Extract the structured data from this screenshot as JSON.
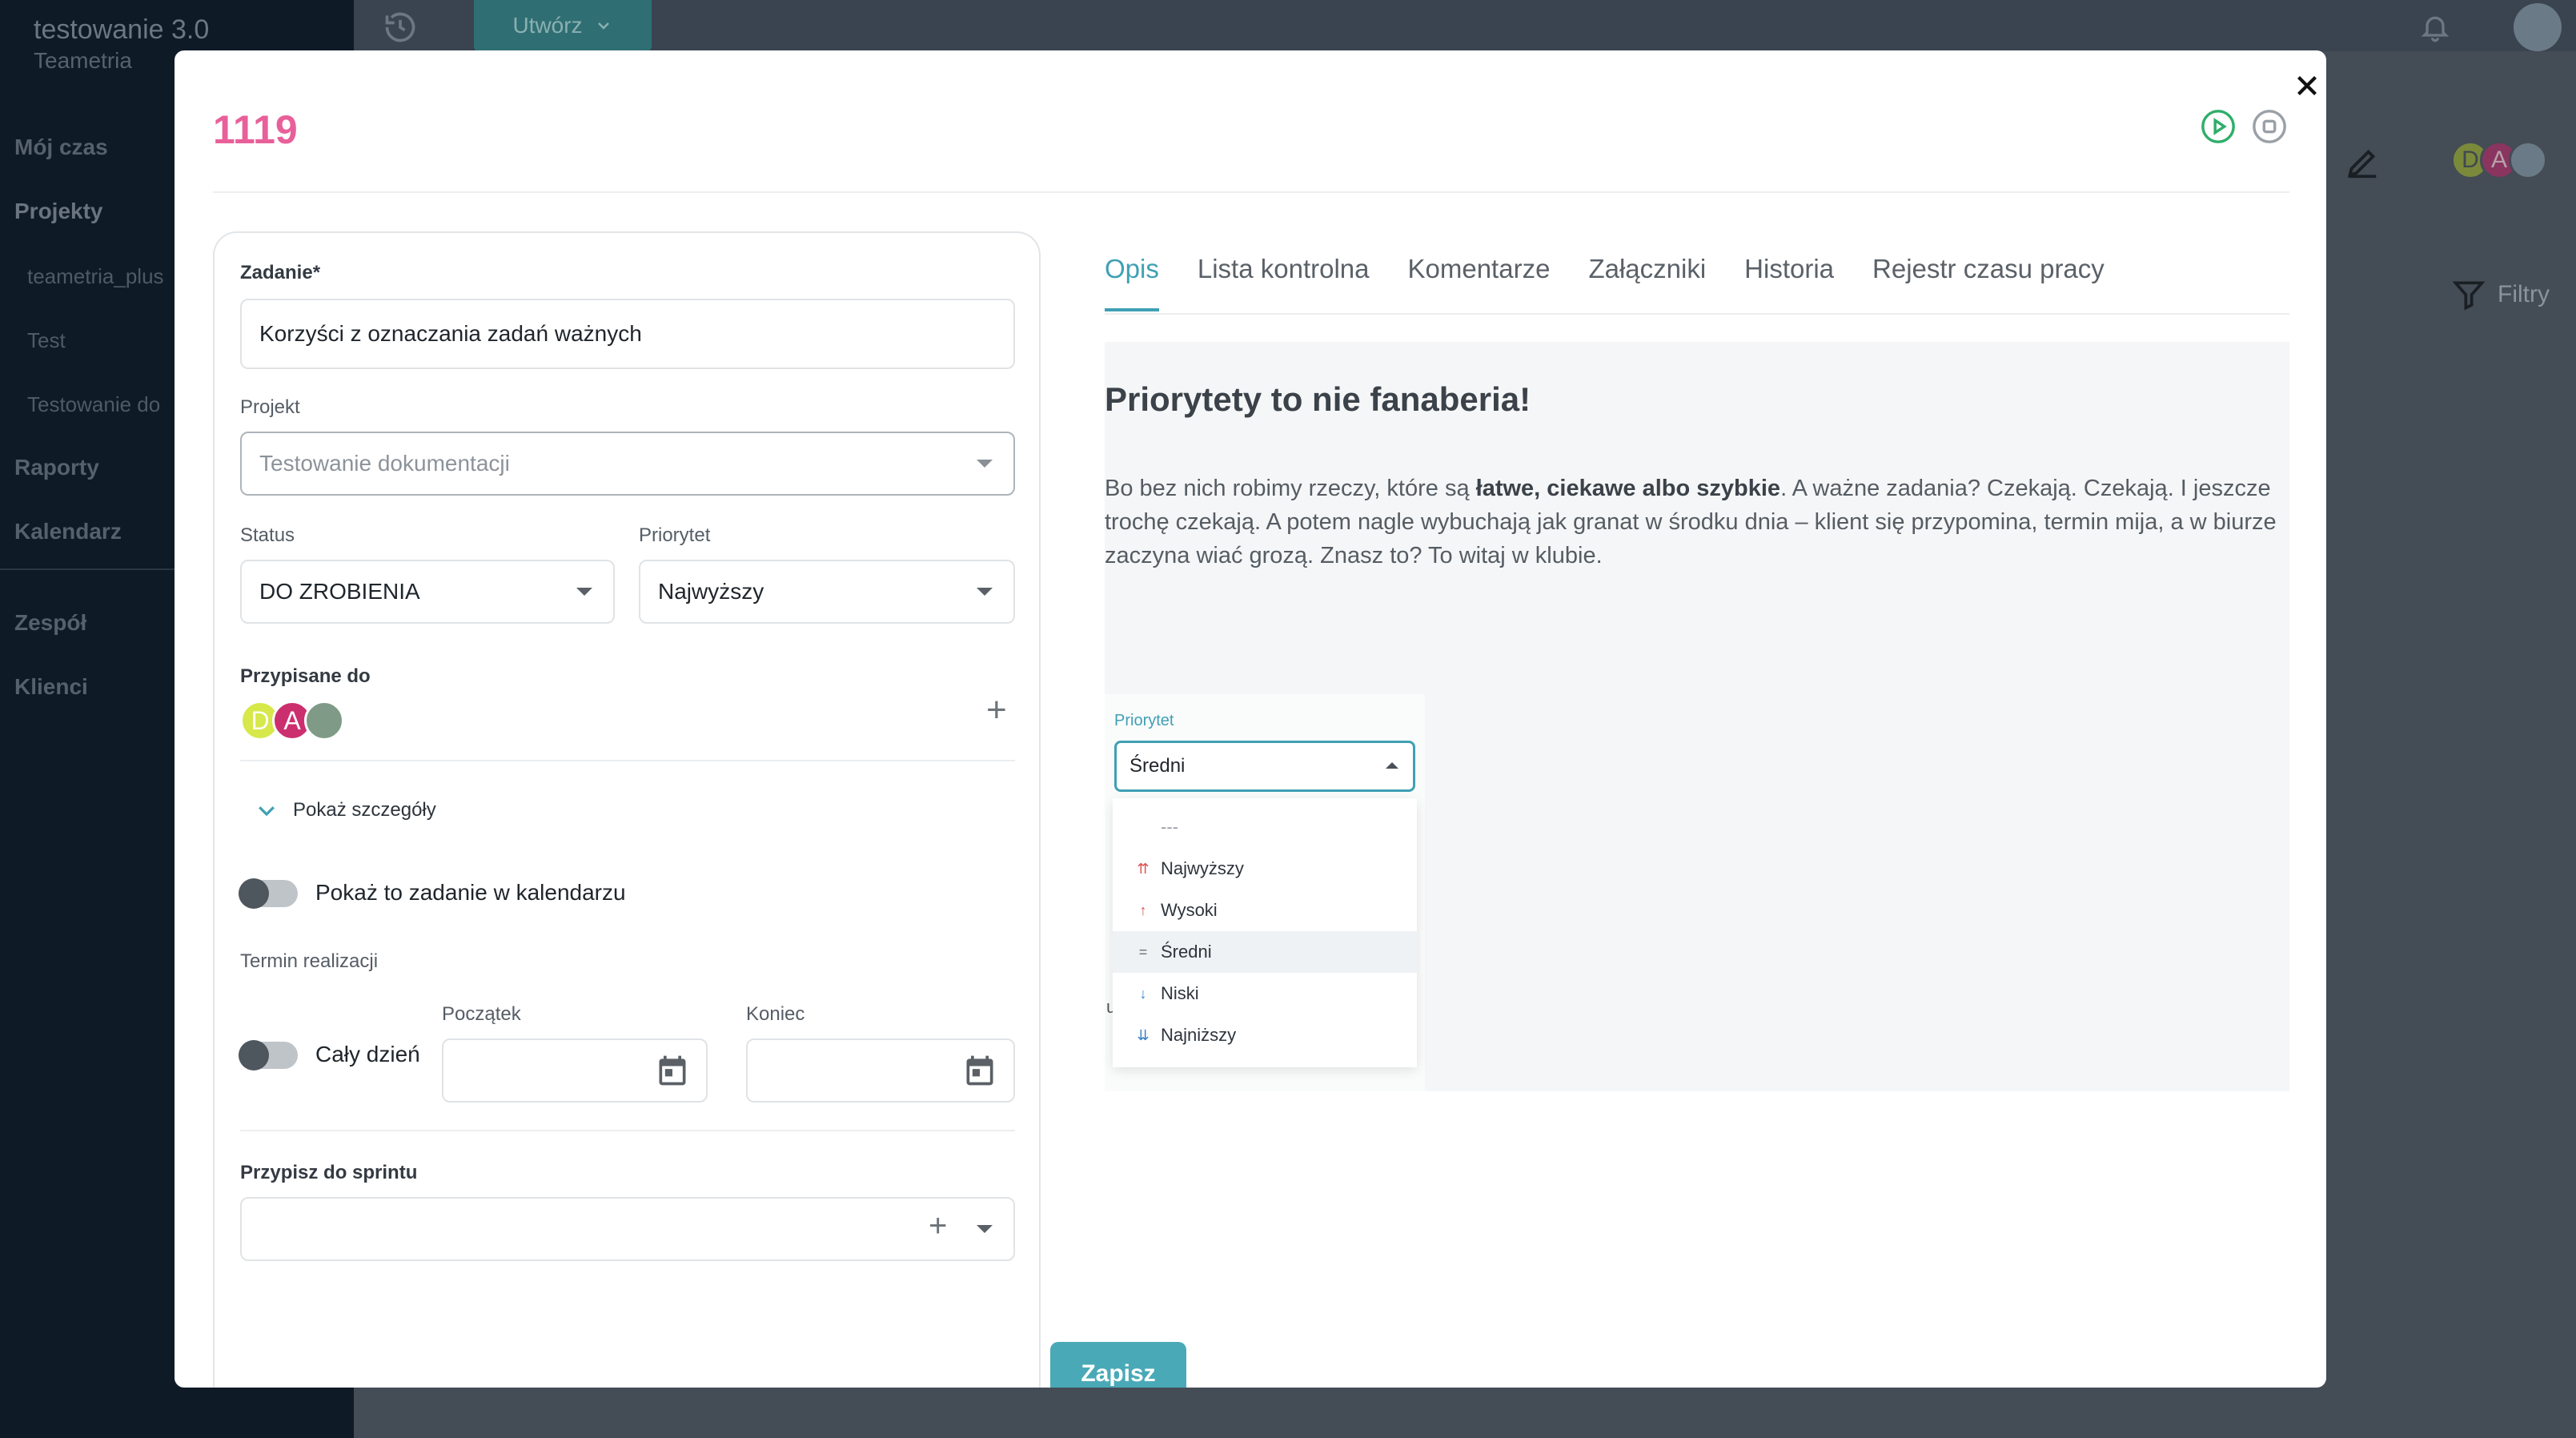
{
  "app": {
    "workspace": "testowanie 3.0",
    "org": "Teametria",
    "create_label": "Utwórz",
    "filters_label": "Filtry",
    "sidebar": [
      {
        "label": "Mój czas"
      },
      {
        "label": "Projekty"
      },
      {
        "label": "teametria_plus"
      },
      {
        "label": "Test"
      },
      {
        "label": "Testowanie do"
      },
      {
        "label": "Raporty"
      },
      {
        "label": "Kalendarz"
      },
      {
        "label": "Zespół"
      },
      {
        "label": "Klienci"
      }
    ],
    "bg_avatars": [
      "D",
      "A"
    ]
  },
  "modal": {
    "task_number": "1119",
    "form": {
      "task_label": "Zadanie*",
      "task_value": "Korzyści z oznaczania zadań ważnych",
      "project_label": "Projekt",
      "project_value": "Testowanie dokumentacji",
      "status_label": "Status",
      "status_value": "DO ZROBIENIA",
      "priority_label": "Priorytet",
      "priority_value": "Najwyższy",
      "assigned_label": "Przypisane do",
      "assignees": [
        "D",
        "A"
      ],
      "show_details": "Pokaż szczegóły",
      "show_in_calendar": "Pokaż to zadanie w kalendarzu",
      "deadline_label": "Termin realizacji",
      "all_day": "Cały dzień",
      "start_label": "Początek",
      "end_label": "Koniec",
      "sprint_label": "Przypisz do sprintu",
      "save": "Zapisz"
    },
    "tabs": [
      {
        "label": "Opis"
      },
      {
        "label": "Lista kontrolna"
      },
      {
        "label": "Komentarze"
      },
      {
        "label": "Załączniki"
      },
      {
        "label": "Historia"
      },
      {
        "label": "Rejestr czasu pracy"
      }
    ],
    "description": {
      "heading": "Priorytety to nie fanaberia!",
      "p_before": "Bo bez nich robimy rzeczy, które są ",
      "p_bold": "łatwe, ciekawe albo szybkie",
      "p_after": ". A ważne zadania? Czekają. Czekają. I jeszcze trochę czekają. A potem nagle wybuchają jak granat w środku dnia – klient się przypomina, termin mija, a w biurze zaczyna wiać grozą. Znasz to? To witaj w klubie.",
      "stray_char": "u"
    },
    "embed": {
      "label": "Priorytet",
      "selected": "Średni",
      "options": [
        {
          "label": "---"
        },
        {
          "label": "Najwyższy",
          "icon": "⇈",
          "color": "#d9534f"
        },
        {
          "label": "Wysoki",
          "icon": "↑",
          "color": "#d9534f"
        },
        {
          "label": "Średni",
          "icon": "=",
          "color": "#6c737a"
        },
        {
          "label": "Niski",
          "icon": "↓",
          "color": "#3b82c4"
        },
        {
          "label": "Najniższy",
          "icon": "⇊",
          "color": "#3b82c4"
        }
      ]
    }
  }
}
